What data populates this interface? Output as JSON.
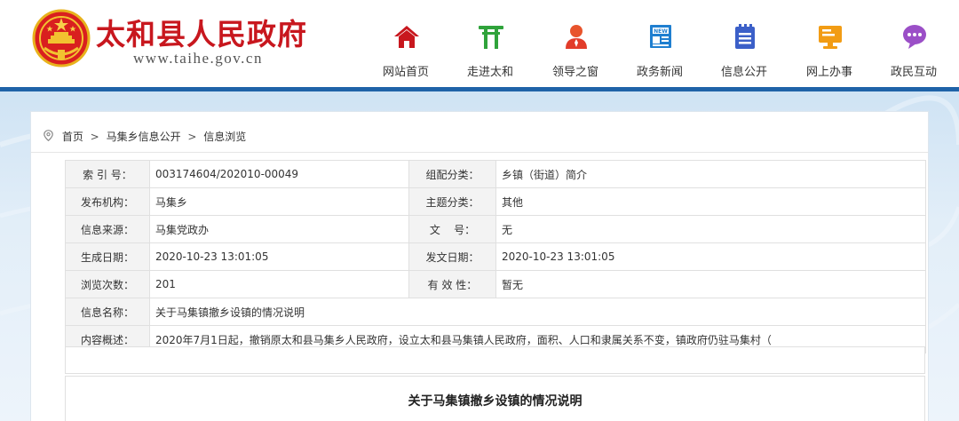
{
  "site": {
    "title": "太和县人民政府",
    "url": "www.taihe.gov.cn"
  },
  "nav": [
    {
      "label": "网站首页",
      "icon": "home-icon",
      "color": "#c8171e"
    },
    {
      "label": "走进太和",
      "icon": "torii-gate-icon",
      "color": "#2fa33b"
    },
    {
      "label": "领导之窗",
      "icon": "person-icon",
      "color": "#e23c2a"
    },
    {
      "label": "政务新闻",
      "icon": "news-icon",
      "color": "#1f7fd0"
    },
    {
      "label": "信息公开",
      "icon": "document-icon",
      "color": "#3b5fc8"
    },
    {
      "label": "网上办事",
      "icon": "monitor-icon",
      "color": "#f29c14"
    },
    {
      "label": "政民互动",
      "icon": "chat-icon",
      "color": "#9b4fc7"
    }
  ],
  "colors": {
    "brand_red": "#c8171e",
    "header_bar": "#1f63a8",
    "label_bg": "#f3f3f3"
  },
  "breadcrumb": {
    "icon": "location-pin-icon",
    "items": [
      "首页",
      "马集乡信息公开",
      "信息浏览"
    ],
    "separator": ">"
  },
  "info": {
    "index_no": {
      "label": "索 引 号：",
      "value": "003174604/202010-00049"
    },
    "category": {
      "label": "组配分类：",
      "value": "乡镇（街道）简介"
    },
    "publisher": {
      "label": "发布机构：",
      "value": "马集乡"
    },
    "topic": {
      "label": "主题分类：",
      "value": "其他"
    },
    "source": {
      "label": "信息来源：",
      "value": "马集党政办"
    },
    "doc_no": {
      "label": "文    号：",
      "value": "无"
    },
    "created": {
      "label": "生成日期：",
      "value": "2020-10-23 13:01:05"
    },
    "issued": {
      "label": "发文日期：",
      "value": "2020-10-23 13:01:05"
    },
    "views": {
      "label": "浏览次数：",
      "value": "201"
    },
    "validity": {
      "label": "有 效 性：",
      "value": "暂无"
    },
    "name": {
      "label": "信息名称：",
      "value": "关于马集镇撤乡设镇的情况说明"
    },
    "summary": {
      "label": "内容概述：",
      "value": "2020年7月1日起，撤销原太和县马集乡人民政府，设立太和县马集镇人民政府，面积、人口和隶属关系不变，镇政府仍驻马集村（"
    }
  },
  "article": {
    "title": "关于马集镇撤乡设镇的情况说明"
  }
}
